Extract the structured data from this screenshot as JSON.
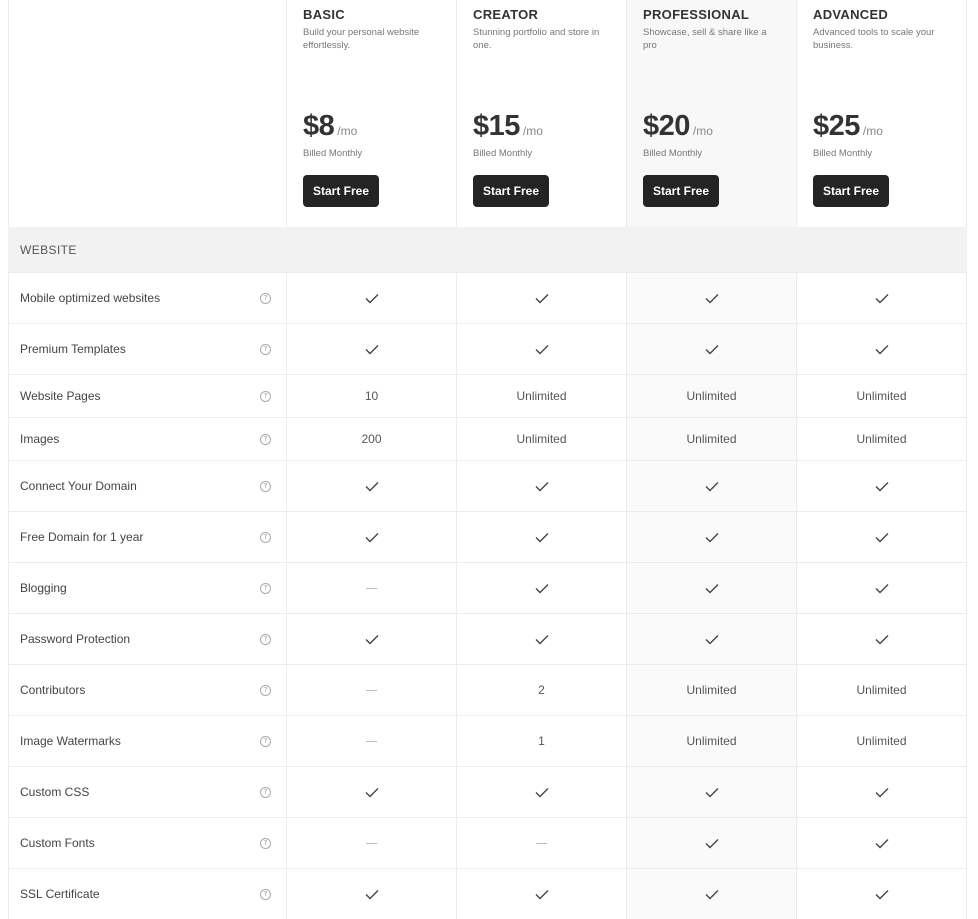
{
  "plans": [
    {
      "name": "BASIC",
      "desc": "Build your personal website effortlessly.",
      "price": "$8",
      "per": "/mo",
      "billed": "Billed Monthly",
      "cta": "Start Free"
    },
    {
      "name": "CREATOR",
      "desc": "Stunning portfolio and store in one.",
      "price": "$15",
      "per": "/mo",
      "billed": "Billed Monthly",
      "cta": "Start Free"
    },
    {
      "name": "PROFESSIONAL",
      "desc": "Showcase, sell & share like a pro",
      "price": "$20",
      "per": "/mo",
      "billed": "Billed Monthly",
      "cta": "Start Free"
    },
    {
      "name": "ADVANCED",
      "desc": "Advanced tools to scale your business.",
      "price": "$25",
      "per": "/mo",
      "billed": "Billed Monthly",
      "cta": "Start Free"
    }
  ],
  "section": {
    "title": "WEBSITE"
  },
  "features": [
    {
      "label": "Mobile optimized websites",
      "values": [
        "check",
        "check",
        "check",
        "check"
      ]
    },
    {
      "label": "Premium Templates",
      "values": [
        "check",
        "check",
        "check",
        "check"
      ]
    },
    {
      "label": "Website Pages",
      "values": [
        "10",
        "Unlimited",
        "Unlimited",
        "Unlimited"
      ]
    },
    {
      "label": "Images",
      "values": [
        "200",
        "Unlimited",
        "Unlimited",
        "Unlimited"
      ]
    },
    {
      "label": "Connect Your Domain",
      "values": [
        "check",
        "check",
        "check",
        "check"
      ]
    },
    {
      "label": "Free Domain for 1 year",
      "values": [
        "check",
        "check",
        "check",
        "check"
      ]
    },
    {
      "label": "Blogging",
      "values": [
        "dash",
        "check",
        "check",
        "check"
      ]
    },
    {
      "label": "Password Protection",
      "values": [
        "check",
        "check",
        "check",
        "check"
      ]
    },
    {
      "label": "Contributors",
      "values": [
        "dash",
        "2",
        "Unlimited",
        "Unlimited"
      ]
    },
    {
      "label": "Image Watermarks",
      "values": [
        "dash",
        "1",
        "Unlimited",
        "Unlimited"
      ]
    },
    {
      "label": "Custom CSS",
      "values": [
        "check",
        "check",
        "check",
        "check"
      ]
    },
    {
      "label": "Custom Fonts",
      "values": [
        "dash",
        "dash",
        "check",
        "check"
      ]
    },
    {
      "label": "SSL Certificate",
      "values": [
        "check",
        "check",
        "check",
        "check"
      ]
    }
  ],
  "icons": {
    "help": "help-circle-icon",
    "included": "check-icon",
    "not_included": "dash-icon"
  },
  "colors": {
    "button_bg": "#242424",
    "section_bg": "#f2f2f2",
    "highlight_col": "#f8f8f8"
  }
}
